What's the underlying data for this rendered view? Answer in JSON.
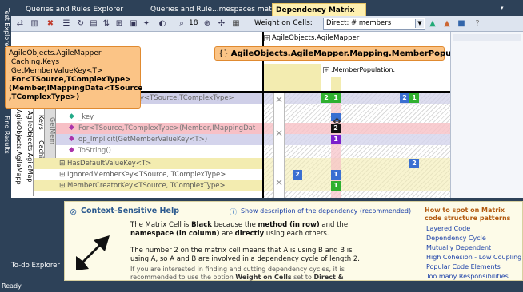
{
  "left_tabs": [
    "Test Explorer",
    "Find Results"
  ],
  "doc_tabs": [
    {
      "label": "Queries and Rules Explorer"
    },
    {
      "label": "Queries and Rule...mespaces mat"
    },
    {
      "label": "Dependency Matrix",
      "active": true
    }
  ],
  "tab_controls": {
    "pin": "⇕",
    "close": "✕"
  },
  "toolbar": {
    "zoom": "18",
    "weight_label": "Weight on Cells:",
    "weight_value": "Direct: # members"
  },
  "matrix": {
    "col_header_top": "AgileObjects.AgileMapper",
    "col_header_sub": ".MemberPopulation.",
    "row_ns_1": "AgileObjects.AgileMapp",
    "row_ns_2": "AgileObjects.AgileMap",
    "row_ns_3": "Keys",
    "row_ns_4": "Caching",
    "row_ns_5": "GetMem",
    "rows": [
      "ingStepKey<TSource,TComplexType>",
      "_key",
      "For<TSource,TComplexType>(Member,IMappingDat",
      "op_Implicit(GetMemberValueKey<T>)",
      "ToString()",
      "HasDefaultValueKey<T>",
      "IgnoredMemberKey<TSource, TComplexType>",
      "MemberCreatorKey<TSource, TComplexType>"
    ],
    "cell_values": [
      "2",
      "1",
      "2",
      "1",
      "2",
      "1",
      "2",
      "1",
      "2",
      "1"
    ]
  },
  "row_callout": [
    "AgileObjects.AgileMapper",
    ".Caching.Keys",
    ".GetMemberValueKey<T>",
    ".For<TSource,TComplexType>",
    "(Member,IMappingData<TSource",
    ",TComplexType>)"
  ],
  "col_callout": "AgileObjects.AgileMapper.Mapping.MemberPopulation",
  "help": {
    "title": "Context-Sensitive Help",
    "show_link": "Show description of the dependency (recommended)",
    "p1_a": "The Matrix Cell is ",
    "p1_b": "Black",
    "p1_c": " because the ",
    "p1_d": "method (in row)",
    "p1_e": " and the ",
    "p1_f": "namespace (in column)",
    "p1_g": " are ",
    "p1_h": "directly",
    "p1_i": " using each others.",
    "p2": "The number 2 on the matrix cell means that A is using B and B is using A, so A and B are involved in a dependency cycle of length 2.",
    "p3_a": "If you are interested in finding and cutting dependency cycles, it is recommended to use the option ",
    "p3_b": "Weight on Cells",
    "p3_c": " set to ",
    "p3_d": "Direct & Indirect depth of use.",
    "side_title": "How to spot on Matrix code structure patterns",
    "side_links": [
      "Layered Code",
      "Dependency Cycle",
      "Mutually Dependent",
      "High Cohesion - Low Coupling",
      "Popular Code Elements",
      "Too many Responsibilities"
    ]
  },
  "todo": "To-do Explorer",
  "status": "Ready"
}
